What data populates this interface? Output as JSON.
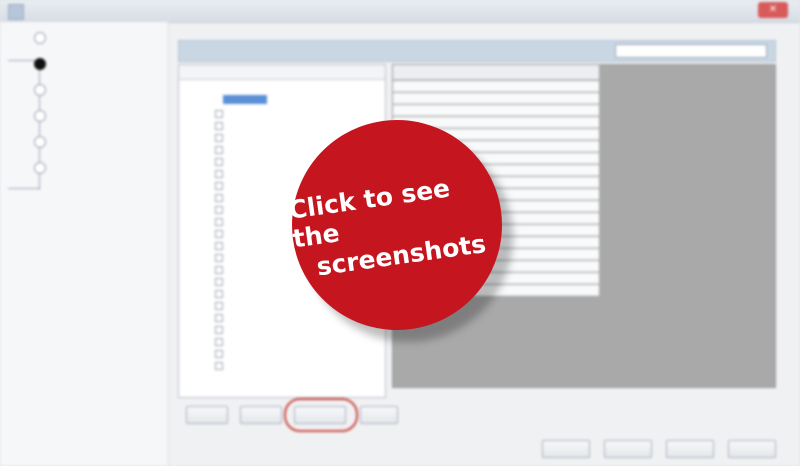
{
  "overlay": {
    "line1": "Click to see the",
    "line2": "screenshots"
  }
}
